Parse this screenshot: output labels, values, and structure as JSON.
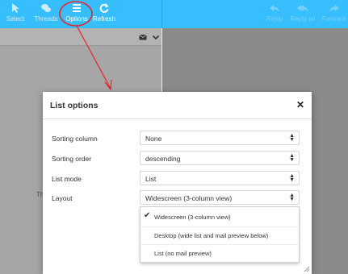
{
  "toolbar": {
    "left": [
      {
        "label": "Select",
        "icon": "cursor-icon",
        "active": false
      },
      {
        "label": "Threads",
        "icon": "threads-icon",
        "active": false
      },
      {
        "label": "Options",
        "icon": "options-icon",
        "active": true
      },
      {
        "label": "Refresh",
        "icon": "refresh-icon",
        "active": true
      }
    ],
    "right": [
      {
        "label": "Reply",
        "icon": "reply-icon"
      },
      {
        "label": "Reply all",
        "icon": "reply-all-icon"
      },
      {
        "label": "Forward",
        "icon": "forward-icon"
      }
    ]
  },
  "list_header": {
    "icons": [
      "envelope-icon",
      "chevron-down-icon"
    ]
  },
  "behind": {
    "text": "Th"
  },
  "dialog": {
    "title": "List options",
    "close_icon": "close-icon",
    "rows": [
      {
        "label": "Sorting column",
        "value": "None"
      },
      {
        "label": "Sorting order",
        "value": "descending"
      },
      {
        "label": "List mode",
        "value": "List"
      },
      {
        "label": "Layout",
        "value": "Widescreen (3-column view)"
      }
    ],
    "layout_options": [
      {
        "label": "Widescreen (3-column view)",
        "selected": true
      },
      {
        "label": "Desktop (wide list and mail preview below)",
        "selected": false
      },
      {
        "label": "List (no mail preview)",
        "selected": false
      }
    ]
  },
  "colors": {
    "toolbar": "#37beff",
    "annotation": "#e8232a",
    "list_panel": "#a6a6a6",
    "preview_panel": "#8a8a8a"
  }
}
